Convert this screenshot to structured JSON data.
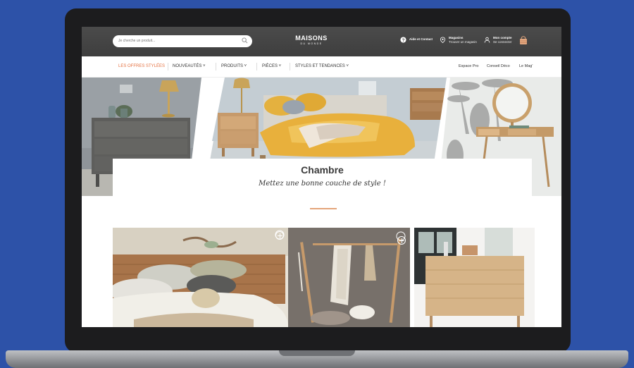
{
  "header": {
    "search_placeholder": "Je cherche un produit...",
    "logo_line1": "MAISONS",
    "logo_line2": "DU MONDE",
    "help_label": "Aide et Contact",
    "stores_label": "Magasins",
    "stores_sub": "Trouver un magasin",
    "account_label": "Mon compte",
    "account_sub": "Se connecter"
  },
  "nav": {
    "items": [
      {
        "label": "LES OFFRES STYLÉES"
      },
      {
        "label": "NOUVEAUTÉS  ˅"
      },
      {
        "label": "PRODUITS  ˅"
      },
      {
        "label": "PIÈCES  ˅"
      },
      {
        "label": "STYLES ET TENDANCES  ˅"
      }
    ],
    "right": [
      {
        "label": "Espace Pro"
      },
      {
        "label": "Conseil Déco"
      },
      {
        "label": "Le Mag'"
      }
    ]
  },
  "hero": {
    "title": "Chambre",
    "subtitle": "Mettez une bonne couche de style !"
  },
  "colors": {
    "accent": "#e4703f",
    "background": "#2d52a8",
    "header_bg": "#444444"
  },
  "icons": [
    "search-icon",
    "help-icon",
    "location-pin-icon",
    "user-icon",
    "basket-icon",
    "plus-icon"
  ]
}
